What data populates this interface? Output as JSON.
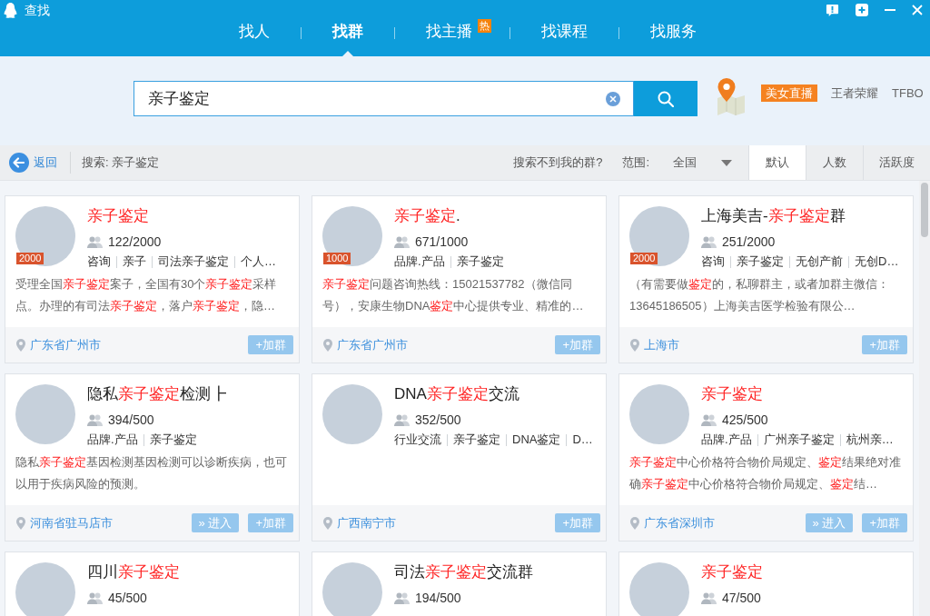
{
  "window": {
    "title": "查找"
  },
  "tabs": [
    {
      "label": "找人",
      "selected": false
    },
    {
      "label": "找群",
      "selected": true
    },
    {
      "label": "找主播",
      "badge": "热",
      "selected": false
    },
    {
      "label": "找课程",
      "selected": false
    },
    {
      "label": "找服务",
      "selected": false
    }
  ],
  "search": {
    "value": "亲子鉴定"
  },
  "hot_searches": [
    {
      "label": "美女直播",
      "highlighted": true
    },
    {
      "label": "王者荣耀",
      "highlighted": false
    },
    {
      "label": "TFBO",
      "highlighted": false
    }
  ],
  "toolbar": {
    "back": "返回",
    "query": "搜索: 亲子鉴定",
    "not_found": "搜索不到我的群?",
    "scope_label": "范围:",
    "scope": "全国",
    "sort_tabs": [
      {
        "label": "默认",
        "selected": true
      },
      {
        "label": "人数",
        "selected": false
      },
      {
        "label": "活跃度",
        "selected": false
      }
    ]
  },
  "groups": [
    {
      "title": [
        {
          "text": "亲子鉴定",
          "highlight": true
        }
      ],
      "avatar_badge": "2000",
      "members": "122/2000",
      "tags": [
        "咨询",
        "亲子",
        "司法亲子鉴定",
        "个人…"
      ],
      "description": [
        {
          "text": "受理全国",
          "highlight": false
        },
        {
          "text": "亲子鉴定",
          "highlight": true
        },
        {
          "text": "案子，全国有30个",
          "highlight": false
        },
        {
          "text": "亲子鉴定",
          "highlight": true
        },
        {
          "text": "采样点。办理的有司法",
          "highlight": false
        },
        {
          "text": "亲子鉴定",
          "highlight": true
        },
        {
          "text": "，落户",
          "highlight": false
        },
        {
          "text": "亲子鉴定",
          "highlight": true
        },
        {
          "text": "，隐…",
          "highlight": false
        }
      ],
      "location": "广东省广州市",
      "buttons": [
        "+加群"
      ]
    },
    {
      "title": [
        {
          "text": "亲子鉴定",
          "highlight": true
        },
        {
          "text": ".",
          "highlight": false
        }
      ],
      "avatar_badge": "1000",
      "members": "671/1000",
      "tags": [
        "品牌.产品",
        "亲子鉴定"
      ],
      "description": [
        {
          "text": "亲子鉴定",
          "highlight": true
        },
        {
          "text": "问题咨询热线：15021537782（微信同号），安康生物DNA",
          "highlight": false
        },
        {
          "text": "鉴定",
          "highlight": true
        },
        {
          "text": "中心提供专业、精准的…",
          "highlight": false
        }
      ],
      "location": "广东省广州市",
      "buttons": [
        "+加群"
      ]
    },
    {
      "title": [
        {
          "text": "上海美吉-",
          "highlight": false
        },
        {
          "text": "亲子鉴定",
          "highlight": true
        },
        {
          "text": "群",
          "highlight": false
        }
      ],
      "avatar_badge": "2000",
      "members": "251/2000",
      "tags": [
        "咨询",
        "亲子鉴定",
        "无创产前",
        "无创D…"
      ],
      "description": [
        {
          "text": "（有需要做",
          "highlight": false
        },
        {
          "text": "鉴定",
          "highlight": true
        },
        {
          "text": "的，私聊群主，或者加群主微信：13645186505）上海美吉医学检验有限公…",
          "highlight": false
        }
      ],
      "location": "上海市",
      "buttons": [
        "+加群"
      ]
    },
    {
      "title": [
        {
          "text": "隐私",
          "highlight": false
        },
        {
          "text": "亲子鉴定",
          "highlight": true
        },
        {
          "text": "检测┣",
          "highlight": false
        }
      ],
      "members": "394/500",
      "tags": [
        "品牌.产品",
        "亲子鉴定"
      ],
      "description": [
        {
          "text": "隐私",
          "highlight": false
        },
        {
          "text": "亲子鉴定",
          "highlight": true
        },
        {
          "text": "基因检测基因检测可以诊断疾病，也可以用于疾病风险的预测。",
          "highlight": false
        }
      ],
      "location": "河南省驻马店市",
      "buttons": [
        "» 进入",
        "+加群"
      ]
    },
    {
      "title": [
        {
          "text": "DNA",
          "highlight": false
        },
        {
          "text": "亲子鉴定",
          "highlight": true
        },
        {
          "text": "交流",
          "highlight": false
        }
      ],
      "members": "352/500",
      "tags": [
        "行业交流",
        "亲子鉴定",
        "DNA鉴定",
        "D…"
      ],
      "location": "广西南宁市",
      "buttons": [
        "+加群"
      ]
    },
    {
      "title": [
        {
          "text": "亲子鉴定",
          "highlight": true
        }
      ],
      "members": "425/500",
      "tags": [
        "品牌.产品",
        "广州亲子鉴定",
        "杭州亲…"
      ],
      "description": [
        {
          "text": "亲子鉴定",
          "highlight": true
        },
        {
          "text": "中心价格符合物价局规定、",
          "highlight": false
        },
        {
          "text": "鉴定",
          "highlight": true
        },
        {
          "text": "结果绝对准确",
          "highlight": false
        },
        {
          "text": "亲子鉴定",
          "highlight": true
        },
        {
          "text": "中心价格符合物价局规定、",
          "highlight": false
        },
        {
          "text": "鉴定",
          "highlight": true
        },
        {
          "text": "结…",
          "highlight": false
        }
      ],
      "location": "广东省深圳市",
      "buttons": [
        "» 进入",
        "+加群"
      ]
    },
    {
      "title": [
        {
          "text": "四川",
          "highlight": false
        },
        {
          "text": "亲子鉴定",
          "highlight": true
        }
      ],
      "members": "45/500"
    },
    {
      "title": [
        {
          "text": "司法",
          "highlight": false
        },
        {
          "text": "亲子鉴定",
          "highlight": true
        },
        {
          "text": "交流群",
          "highlight": false
        }
      ],
      "members": "194/500"
    },
    {
      "title": [
        {
          "text": "亲子鉴定",
          "highlight": true
        }
      ],
      "members": "47/500"
    }
  ]
}
